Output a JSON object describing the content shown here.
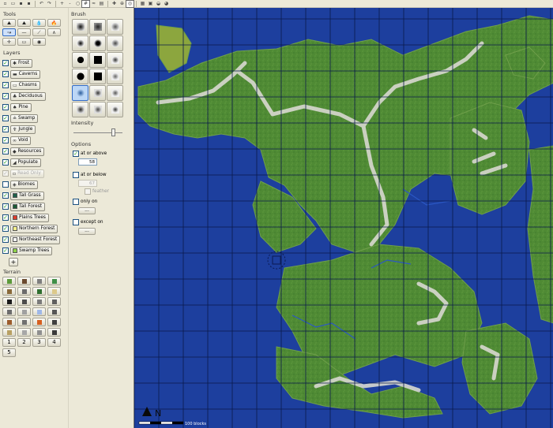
{
  "toolbar": {
    "buttons": [
      {
        "name": "new-world-icon",
        "glyph": "▫"
      },
      {
        "name": "open-world-icon",
        "glyph": "▭"
      },
      {
        "name": "save-world-icon",
        "glyph": "▪"
      },
      {
        "name": "save-as-icon",
        "glyph": "▪"
      },
      {
        "name": "undo-icon",
        "glyph": "↶"
      },
      {
        "name": "redo-icon",
        "glyph": "↷"
      },
      {
        "name": "zoom-in-icon",
        "glyph": "+"
      },
      {
        "name": "zoom-out-icon",
        "glyph": "-"
      },
      {
        "name": "zoom-reset-icon",
        "glyph": "○"
      },
      {
        "name": "grid-icon",
        "glyph": "#"
      },
      {
        "name": "contours-icon",
        "glyph": "≈"
      },
      {
        "name": "overlay-icon",
        "glyph": "▤"
      },
      {
        "name": "spawn-icon",
        "glyph": "✚"
      },
      {
        "name": "move-to-spawn-icon",
        "glyph": "⊕"
      },
      {
        "name": "move-to-origin-icon",
        "glyph": "◎"
      },
      {
        "name": "image-view-icon",
        "glyph": "▦"
      },
      {
        "name": "3d-view-icon",
        "glyph": "▣"
      },
      {
        "name": "export-icon",
        "glyph": "◒"
      },
      {
        "name": "world-info-icon",
        "glyph": "◕"
      }
    ]
  },
  "tools": {
    "title": "Tools",
    "buttons": [
      {
        "name": "raise-mountain-tool",
        "glyph": "⛰"
      },
      {
        "name": "raise-lower-tool",
        "glyph": "⛰"
      },
      {
        "name": "water-tool",
        "glyph": "💧"
      },
      {
        "name": "lava-tool",
        "glyph": "🔥"
      },
      {
        "name": "smooth-tool",
        "glyph": "↝",
        "selected": true
      },
      {
        "name": "flatten-tool",
        "glyph": "—"
      },
      {
        "name": "height-tool",
        "glyph": "⟋"
      },
      {
        "name": "sponge-tool",
        "glyph": "∧"
      },
      {
        "name": "set-spawn-tool",
        "glyph": "✛"
      },
      {
        "name": "text-tool",
        "glyph": "▭"
      },
      {
        "name": "global-operations-tool",
        "glyph": "◉"
      }
    ]
  },
  "layers": {
    "title": "Layers",
    "items": [
      {
        "label": "Frost",
        "glyph": "✱",
        "checked": true
      },
      {
        "label": "Caverns",
        "glyph": "▬",
        "checked": true
      },
      {
        "label": "Chasms",
        "glyph": "▭",
        "checked": true
      },
      {
        "label": "Deciduous",
        "glyph": "♣",
        "checked": true
      },
      {
        "label": "Pine",
        "glyph": "♠",
        "checked": true
      },
      {
        "label": "Swamp",
        "glyph": "≗",
        "checked": true
      },
      {
        "label": "Jungle",
        "glyph": "♆",
        "checked": true
      },
      {
        "label": "Void",
        "glyph": "∞",
        "checked": true
      },
      {
        "label": "Resources",
        "glyph": "◆",
        "checked": true
      },
      {
        "label": "Populate",
        "glyph": "◢",
        "checked": true
      },
      {
        "label": "Read Only",
        "glyph": "▫",
        "checked": true,
        "disabled": true
      },
      {
        "label": "Biomes",
        "glyph": "◈",
        "checked": false
      },
      {
        "label": "Tall Grass",
        "swatch": "#20604a",
        "checked": true
      },
      {
        "label": "Tall Forest",
        "swatch": "#1b5a36",
        "checked": true
      },
      {
        "label": "Plains Trees",
        "swatch": "#e03d2c",
        "checked": true
      },
      {
        "label": "Northern Forest",
        "swatch": "#f4f08a",
        "checked": true
      },
      {
        "label": "Northeast Forest",
        "swatch": "#f4f4f4",
        "checked": true
      },
      {
        "label": "Swamp Trees",
        "swatch": "#8fd14a",
        "checked": true
      }
    ],
    "add_label": "+"
  },
  "terrain": {
    "title": "Terrain",
    "blocks": [
      "#5d9a3a",
      "#6a4a2f",
      "#7f7f7f",
      "#3f8f47",
      "#8a6a3a",
      "#6b6b6b",
      "#2f6f2f",
      "#dcc98a",
      "#1a1a1a",
      "#4c4c4c",
      "#7b7b7b",
      "#5f5f5f",
      "#6d6d6d",
      "#a0a0a0",
      "#9fb8e8",
      "#565656",
      "#9c5c2c",
      "#707070",
      "#d65f1f",
      "#3f3f3f",
      "#b8a063",
      "#a7a7a7",
      "#8f8f8f",
      "#3a3a3a"
    ],
    "pages": [
      "1",
      "2",
      "3",
      "4",
      "5"
    ]
  },
  "brush": {
    "title": "Brush",
    "shapes": [
      "soft-square",
      "hard-square",
      "noise-square",
      "soft-round",
      "medium-round",
      "noise-round",
      "solid-circle",
      "solid-square",
      "spotted",
      "solid-disc",
      "solid-block",
      "scatter",
      "cloud-a",
      "cloud-b",
      "cloud-c",
      "blob-a",
      "blob-b",
      "blob-c"
    ],
    "selected_index": 12,
    "intensity_label": "Intensity",
    "intensity": 0.8
  },
  "options": {
    "title": "Options",
    "at_or_above_label": "at or above",
    "at_or_above_checked": true,
    "at_or_above_value": "58",
    "at_or_below_label": "at or below",
    "at_or_below_checked": false,
    "at_or_below_value": "67",
    "feather_label": "feather",
    "only_on_label": "only on",
    "only_on_button": "...",
    "except_on_label": "except on",
    "except_on_button": "..."
  },
  "map": {
    "scale_label": "100 blocks",
    "water_color": "#1d3f9e",
    "land_color": "#4f8a34",
    "grid_color": "#0a1a4a"
  }
}
